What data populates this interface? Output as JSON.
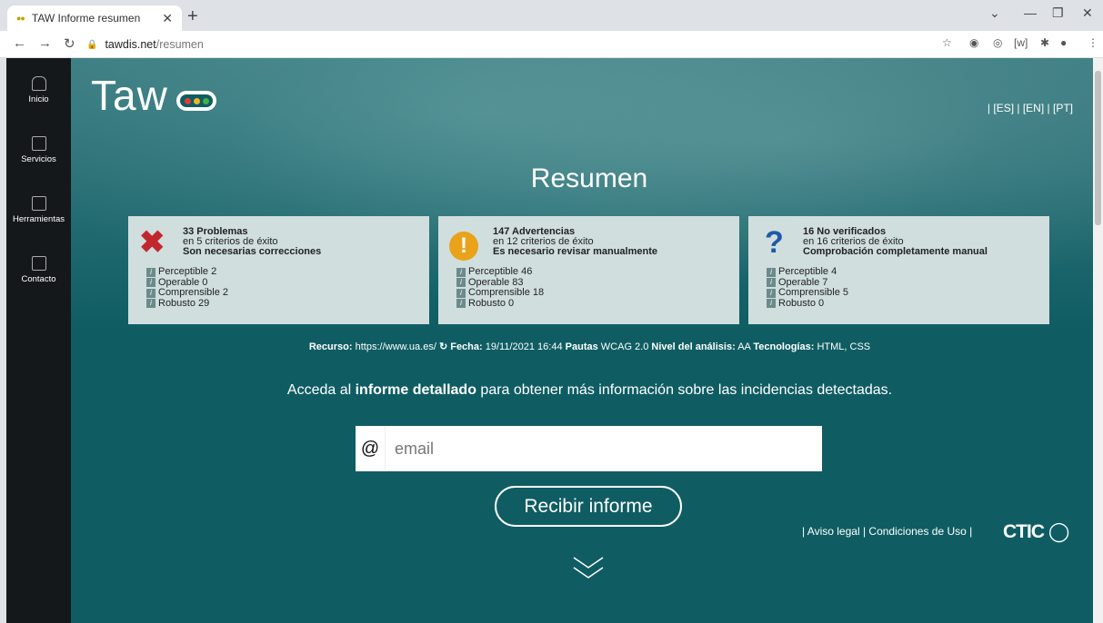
{
  "browser": {
    "tab_title": "TAW Informe resumen",
    "url_host": "tawdis.net",
    "url_path": "/resumen"
  },
  "sidebar": {
    "items": [
      {
        "label": "Inicio"
      },
      {
        "label": "Servicios"
      },
      {
        "label": "Herramientas"
      },
      {
        "label": "Contacto"
      }
    ]
  },
  "header": {
    "logo_text": "Taw",
    "langs": [
      "[ES]",
      "[EN]",
      "[PT]"
    ],
    "title": "Resumen"
  },
  "cards": [
    {
      "icon": "error-cross-icon",
      "count_label": "33 Problemas",
      "criteria": "en 5 criterios de éxito",
      "note": "Son necesarias correcciones",
      "items": [
        "Perceptible 2",
        "Operable 0",
        "Comprensible 2",
        "Robusto 29"
      ]
    },
    {
      "icon": "warning-icon",
      "count_label": "147 Advertencias",
      "criteria": "en 12 criterios de éxito",
      "note": "Es necesario revisar manualmente",
      "items": [
        "Perceptible 46",
        "Operable 83",
        "Comprensible 18",
        "Robusto 0"
      ]
    },
    {
      "icon": "question-icon",
      "count_label": "16 No verificados",
      "criteria": "en 16 criterios de éxito",
      "note": "Comprobación completamente manual",
      "items": [
        "Perceptible 4",
        "Operable 7",
        "Comprensible 5",
        "Robusto 0"
      ]
    }
  ],
  "meta": {
    "recurso_label": "Recurso:",
    "recurso_value": "https://www.ua.es/",
    "fecha_label": "Fecha:",
    "fecha_value": "19/11/2021 16:44",
    "pautas_label": "Pautas",
    "pautas_value": "WCAG 2.0",
    "nivel_label": "Nivel del análisis:",
    "nivel_value": "AA",
    "tec_label": "Tecnologías:",
    "tec_value": "HTML, CSS"
  },
  "cta": {
    "before": "Acceda al ",
    "strong": "informe detallado",
    "after": " para obtener más información sobre las incidencias detectadas."
  },
  "form": {
    "at_symbol": "@",
    "email_placeholder": "email",
    "submit_label": "Recibir informe"
  },
  "footer": {
    "aviso": "Aviso legal",
    "condiciones": "Condiciones de Uso",
    "brand": "CTIC"
  },
  "colors": {
    "page_bg": "#0f5d63",
    "sidebar_bg": "#15181b",
    "card_bg": "#d0dede",
    "error": "#c0282d",
    "warning": "#e9a21a",
    "question": "#1e5aa8"
  }
}
